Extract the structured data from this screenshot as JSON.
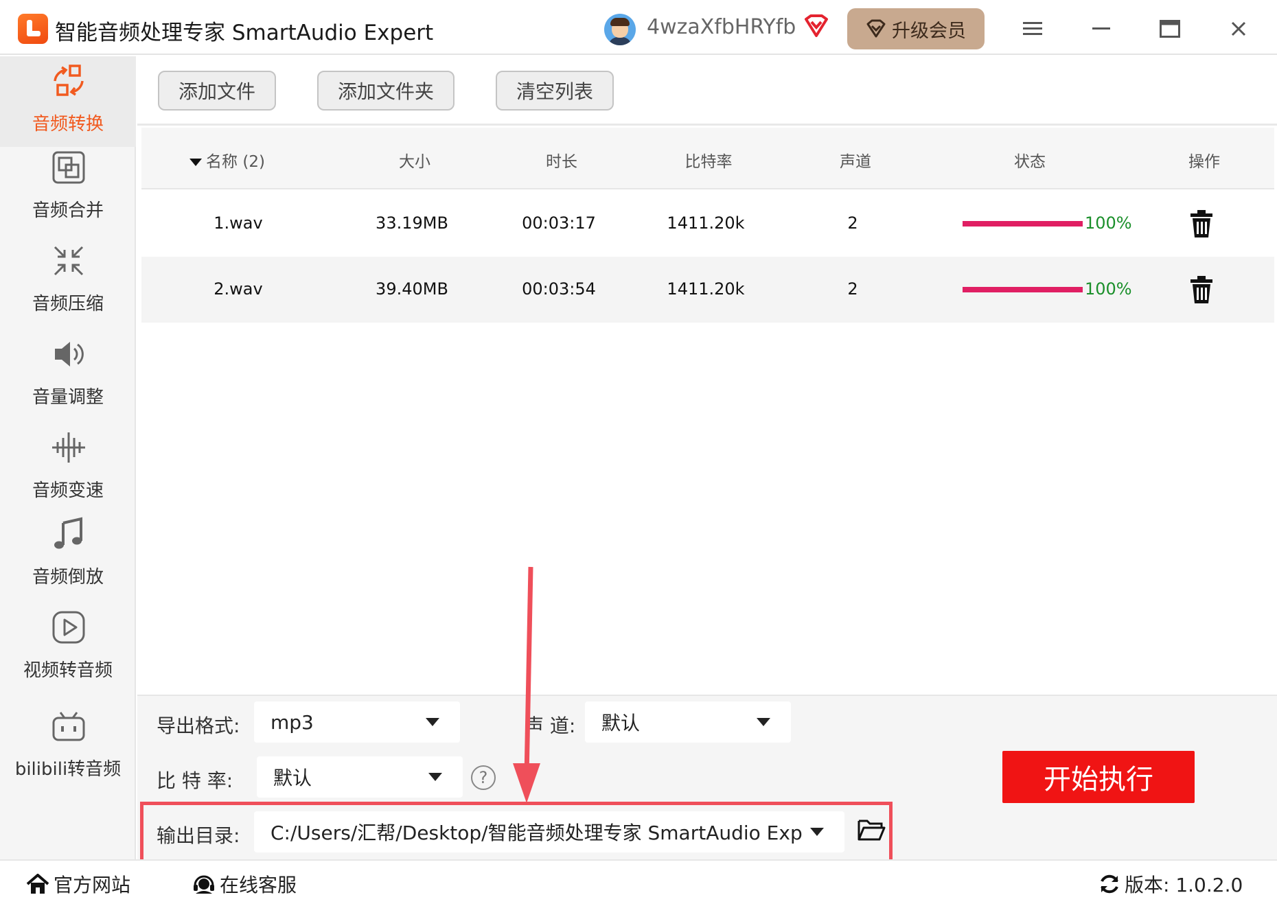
{
  "app": {
    "title": "智能音频处理专家 SmartAudio Expert",
    "username": "4wzaXfbHRYfb",
    "upgrade_label": "升级会员",
    "accent_color": "#f15a1f"
  },
  "sidebar": {
    "items": [
      {
        "label": "音频转换",
        "icon": "audio-convert-icon",
        "active": true
      },
      {
        "label": "音频合并",
        "icon": "audio-merge-icon"
      },
      {
        "label": "音频压缩",
        "icon": "audio-compress-icon"
      },
      {
        "label": "音量调整",
        "icon": "volume-icon"
      },
      {
        "label": "音频变速",
        "icon": "speed-icon"
      },
      {
        "label": "音频倒放",
        "icon": "music-note-icon"
      },
      {
        "label": "视频转音频",
        "icon": "play-icon"
      },
      {
        "label": "bilibili转音频",
        "icon": "bilibili-icon"
      }
    ]
  },
  "toolbar": {
    "add_file": "添加文件",
    "add_folder": "添加文件夹",
    "clear_list": "清空列表"
  },
  "table": {
    "headers": {
      "name": "名称 (2)",
      "size": "大小",
      "duration": "时长",
      "bitrate": "比特率",
      "channels": "声道",
      "status": "状态",
      "actions": "操作"
    },
    "rows": [
      {
        "name": "1.wav",
        "size": "33.19MB",
        "duration": "00:03:17",
        "bitrate": "1411.20k",
        "channels": "2",
        "progress": 1.0,
        "progress_text": "100%"
      },
      {
        "name": "2.wav",
        "size": "39.40MB",
        "duration": "00:03:54",
        "bitrate": "1411.20k",
        "channels": "2",
        "progress": 1.0,
        "progress_text": "100%"
      }
    ]
  },
  "settings": {
    "format_label": "导出格式:",
    "format_value": "mp3",
    "channel_label": "声 道:",
    "channel_value": "默认",
    "bitrate_label": "比 特 率:",
    "bitrate_value": "默认",
    "help_text": "?",
    "output_label": "输出目录:",
    "output_value": "C:/Users/汇帮/Desktop/智能音频处理专家 SmartAudio Exp",
    "start_label": "开始执行"
  },
  "footer": {
    "website": "官方网站",
    "support": "在线客服",
    "version": "版本: 1.0.2.0"
  }
}
